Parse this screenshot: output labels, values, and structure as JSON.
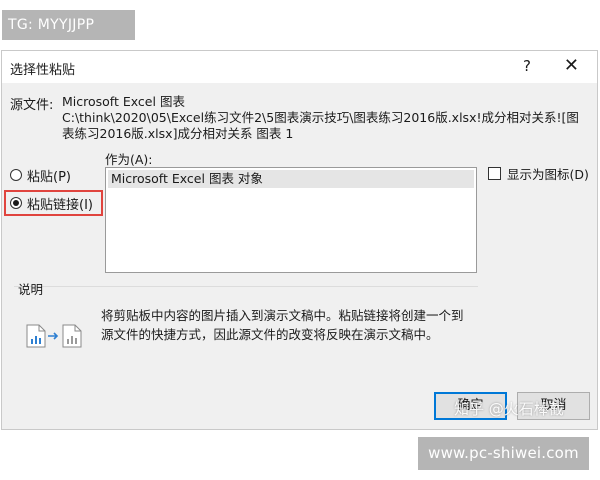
{
  "top_tag": "TG: MYYJJPP",
  "dialog": {
    "title": "选择性粘贴",
    "help_glyph": "?",
    "close_glyph": "✕",
    "source_label": "源文件:",
    "source_lines": [
      "Microsoft Excel 图表",
      "C:\\think\\2020\\05\\Excel练习文件2\\5图表演示技巧\\图表练习2016版.xlsx!成分相对关系![图",
      "表练习2016版.xlsx]成分相对关系 图表 1"
    ],
    "as_label": "作为(A):",
    "radio_options": [
      {
        "label": "粘贴(P)",
        "checked": false
      },
      {
        "label": "粘贴链接(I)",
        "checked": true
      }
    ],
    "list_items": [
      "Microsoft Excel 图表 对象"
    ],
    "display_as_icon_label": "显示为图标(D)",
    "description_label": "说明",
    "description_text": "将剪贴板中内容的图片插入到演示文稿中。粘贴链接将创建一个到源文件的快捷方式，因此源文件的改变将反映在演示文稿中。",
    "ok_label": "确定",
    "cancel_label": "取消"
  },
  "watermark_text": "知乎 @火石棒截",
  "bottom_tag": "www.pc-shiwei.com",
  "colors": {
    "highlight_border": "#e0443e",
    "focus_border": "#0078d7",
    "dialog_bg": "#f0f0f0",
    "tag_bg": "#b5b5b5",
    "icon_blue": "#2d7fd1"
  },
  "icons": [
    "help-icon",
    "close-icon",
    "document-icon",
    "arrow-icon"
  ]
}
